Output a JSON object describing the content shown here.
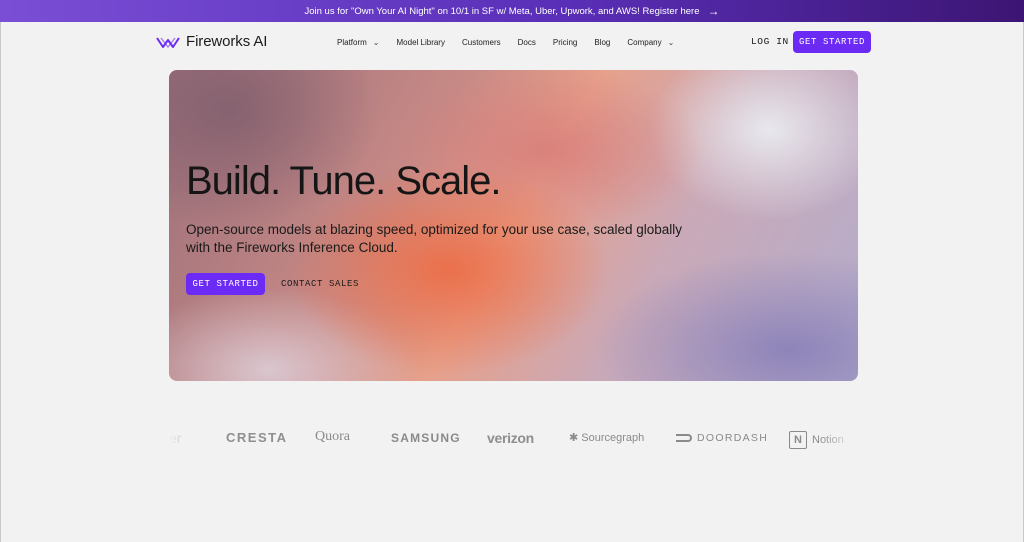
{
  "announcement": {
    "text": "Join us for \"Own Your AI Night\" on 10/1 in SF w/ Meta, Uber, Upwork, and AWS! Register here",
    "arrow_icon": "arrow-right-icon"
  },
  "nav": {
    "logo_text": "Fireworks AI",
    "logo_icon": "fireworks-logo-icon",
    "menu": [
      {
        "label": "Platform",
        "has_dropdown": true
      },
      {
        "label": "Model Library",
        "has_dropdown": false
      },
      {
        "label": "Customers",
        "has_dropdown": false
      },
      {
        "label": "Docs",
        "has_dropdown": false
      },
      {
        "label": "Pricing",
        "has_dropdown": false
      },
      {
        "label": "Blog",
        "has_dropdown": false
      },
      {
        "label": "Company",
        "has_dropdown": true
      }
    ],
    "login_label": "LOG IN",
    "cta_label": "GET STARTED"
  },
  "hero": {
    "title": "Build. Tune. Scale.",
    "subtitle": "Open-source models at blazing speed, optimized for your use case, scaled globally with the Fireworks Inference Cloud.",
    "cta_label": "GET STARTED",
    "secondary_label": "CONTACT SALES"
  },
  "customer_logos": [
    {
      "name": "uber-logo",
      "text": "er"
    },
    {
      "name": "cresta-logo",
      "text": "CRESTA"
    },
    {
      "name": "quora-logo",
      "text": "Quora"
    },
    {
      "name": "samsung-logo",
      "text": "SAMSUNG"
    },
    {
      "name": "verizon-logo",
      "text": "verizon"
    },
    {
      "name": "sourcegraph-logo",
      "text": "✱ Sourcegraph"
    },
    {
      "name": "doordash-logo",
      "text": "DOORDASH"
    },
    {
      "name": "notion-logo",
      "text": "Notion"
    }
  ],
  "colors": {
    "accent": "#6b2bf5",
    "banner_start": "#7a4fd6",
    "banner_end": "#3c1573",
    "background": "#f3f2f2"
  }
}
